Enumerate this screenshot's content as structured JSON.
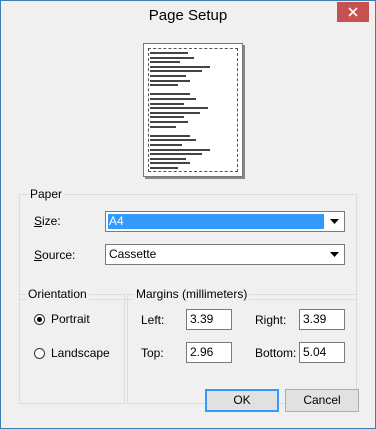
{
  "window": {
    "title": "Page Setup"
  },
  "paper": {
    "legend": "Paper",
    "size_label": "Size:",
    "size_value": "A4",
    "source_label": "Source:",
    "source_value": "Cassette"
  },
  "orientation": {
    "legend": "Orientation",
    "portrait": "Portrait",
    "landscape": "Landscape",
    "selected": "Portrait"
  },
  "margins": {
    "legend": "Margins (millimeters)",
    "left_label": "Left:",
    "left_value": "3.39",
    "right_label": "Right:",
    "right_value": "3.39",
    "top_label": "Top:",
    "top_value": "2.96",
    "bottom_label": "Bottom:",
    "bottom_value": "5.04"
  },
  "buttons": {
    "ok": "OK",
    "cancel": "Cancel"
  },
  "icons": {
    "close": "close-icon",
    "dropdown": "chevron-down-icon"
  }
}
